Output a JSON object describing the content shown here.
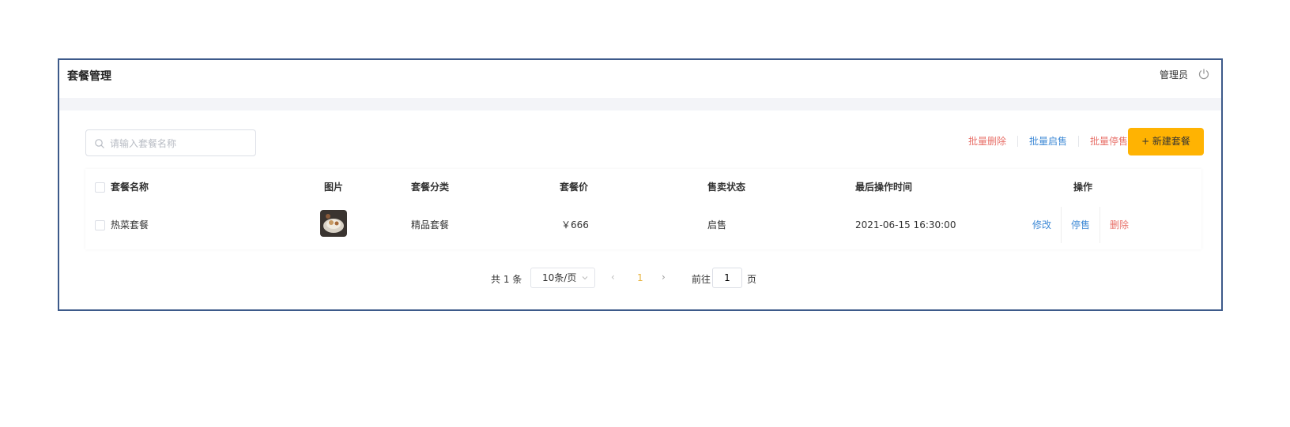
{
  "header": {
    "title": "套餐管理",
    "user": "管理员"
  },
  "search": {
    "placeholder": "请输入套餐名称",
    "value": ""
  },
  "batch_actions": [
    {
      "label": "批量删除",
      "color": "#e8716a"
    },
    {
      "label": "批量启售",
      "color": "#418bd6"
    },
    {
      "label": "批量停售",
      "color": "#e8716a"
    }
  ],
  "new_button": {
    "label": "+ 新建套餐",
    "color": "#ffb302"
  },
  "table": {
    "columns": [
      "套餐名称",
      "图片",
      "套餐分类",
      "套餐价",
      "售卖状态",
      "最后操作时间",
      "操作"
    ],
    "rows": [
      {
        "name": "热菜套餐",
        "image": "food-thumbnail",
        "category": "精品套餐",
        "price": "￥666",
        "status": "启售",
        "updated": "2021-06-15 16:30:00",
        "ops": [
          "修改",
          "停售",
          "删除"
        ]
      }
    ]
  },
  "pagination": {
    "total": "共 1 条",
    "page_size": "10条/页",
    "current_page": "1",
    "goto_prefix": "前往",
    "goto_value": "1",
    "goto_suffix": "页"
  }
}
